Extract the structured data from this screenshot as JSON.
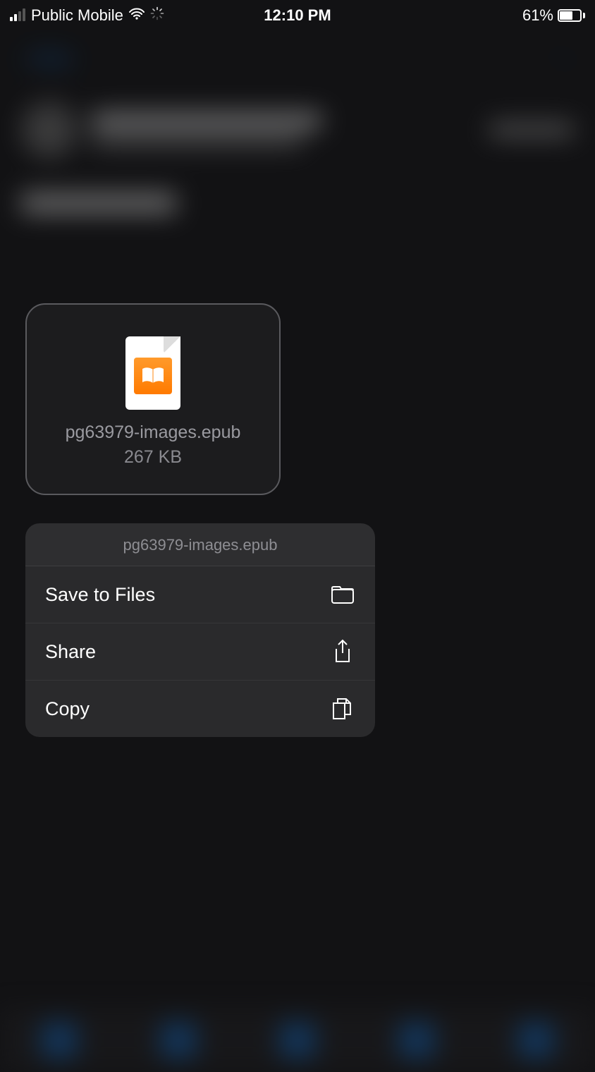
{
  "status_bar": {
    "carrier": "Public Mobile",
    "time": "12:10 PM",
    "battery_percent": "61%"
  },
  "file_preview": {
    "filename": "pg63979-images.epub",
    "filesize": "267 KB"
  },
  "context_menu": {
    "title": "pg63979-images.epub",
    "items": [
      {
        "label": "Save to Files",
        "icon": "folder-icon"
      },
      {
        "label": "Share",
        "icon": "share-icon"
      },
      {
        "label": "Copy",
        "icon": "copy-icon"
      }
    ]
  }
}
